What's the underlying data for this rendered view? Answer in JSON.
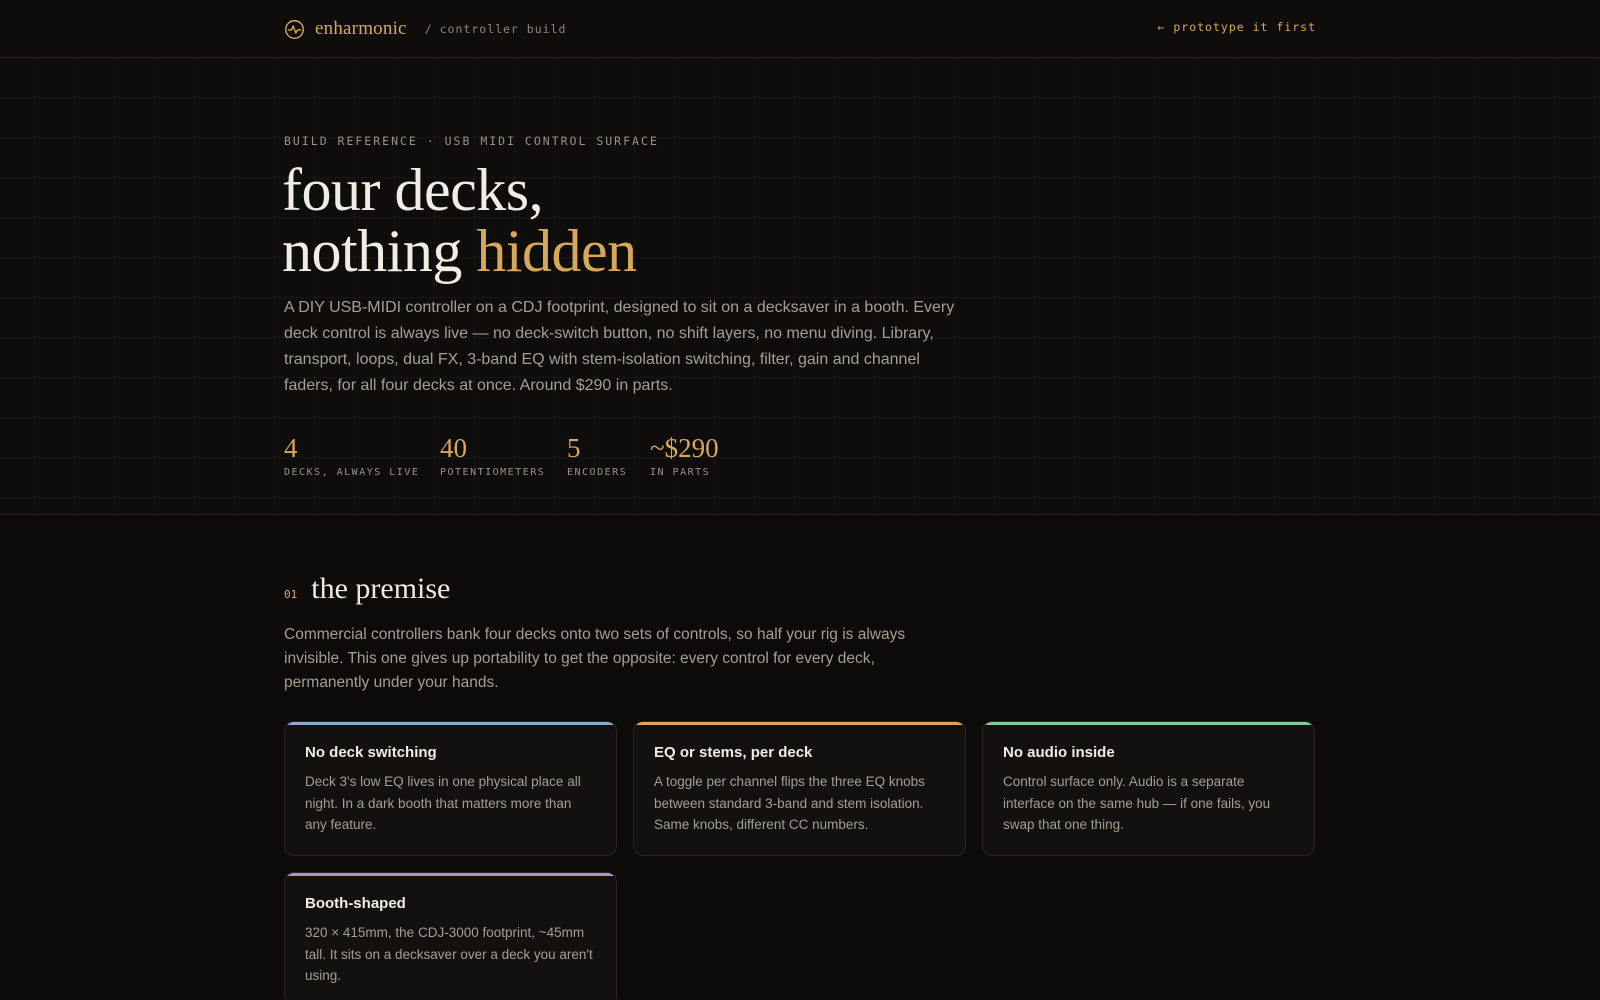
{
  "topbar": {
    "brand_name": "enharmonic",
    "crumb_slash": "/",
    "crumb": "controller build",
    "link": "← prototype it first",
    "logo_icon": "waveform-circle-icon"
  },
  "hero": {
    "eyebrow": "BUILD REFERENCE · USB MIDI CONTROL SURFACE",
    "headline_line1": "four decks,",
    "headline_line2_plain": "nothing ",
    "headline_line2_accent": "hidden",
    "lede": "A DIY USB-MIDI controller on a CDJ footprint, designed to sit on a decksaver in a booth. Every deck control is always live — no deck-switch button, no shift layers, no menu diving. Library, transport, loops, dual FX, 3-band EQ with stem-isolation switching, filter, gain and channel faders, for all four decks at once. Around $290 in parts.",
    "stats": [
      {
        "value": "4",
        "label": "DECKS, ALWAYS LIVE"
      },
      {
        "value": "40",
        "label": "POTENTIOMETERS"
      },
      {
        "value": "5",
        "label": "ENCODERS"
      },
      {
        "value": "~$290",
        "label": "IN PARTS"
      }
    ]
  },
  "premise": {
    "number": "01",
    "title": "the premise",
    "body": "Commercial controllers bank four decks onto two sets of controls, so half your rig is always invisible. This one gives up portability to get the opposite: every control for every deck, permanently under your hands.",
    "cards": [
      {
        "title": "No deck switching",
        "text": "Deck 3's low EQ lives in one physical place all night. In a dark booth that matters more than any feature.",
        "accent": "#8fa6c4"
      },
      {
        "title": "EQ or stems, per deck",
        "text": "A toggle per channel flips the three EQ knobs between standard 3-band and stem isolation. Same knobs, different CC numbers.",
        "accent": "#d8a85a"
      },
      {
        "title": "No audio inside",
        "text": "Control surface only. Audio is a separate interface on the same hub — if one fails, you swap that one thing.",
        "accent": "#8cc79a"
      },
      {
        "title": "Booth-shaped",
        "text": "320 × 415mm, the CDJ-3000 footprint, ~45mm tall. It sits on a decksaver over a deck you aren't using.",
        "accent": "#b38fd1"
      }
    ]
  },
  "colors": {
    "background": "#0c0b0a",
    "accent_gold": "#d8a85a",
    "text_muted": "#a69e94"
  }
}
